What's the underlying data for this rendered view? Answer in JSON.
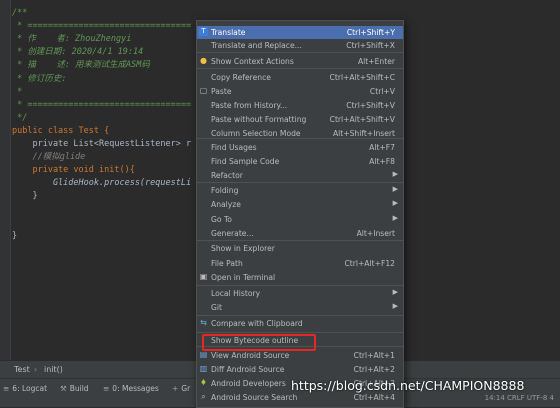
{
  "editor": {
    "lines": [
      {
        "cls": "c-doc",
        "text": "/**"
      },
      {
        "cls": "c-doc",
        "text": " * ================================"
      },
      {
        "cls": "c-doc",
        "text": " * 作    者: ZhouZhengyi"
      },
      {
        "cls": "c-doc",
        "text": " * 创建日期: 2020/4/1 19:14"
      },
      {
        "cls": "c-doc",
        "text": " * 描    述: 用来测试生成ASM码"
      },
      {
        "cls": "c-doc",
        "text": " * 修订历史:"
      },
      {
        "cls": "c-doc",
        "text": " * "
      },
      {
        "cls": "c-doc",
        "text": " * ================================"
      },
      {
        "cls": "c-doc",
        "text": " */"
      },
      {
        "cls": "c-kw",
        "text": "public class Test {"
      },
      {
        "cls": "code",
        "text": "    private List<RequestListener> r"
      },
      {
        "cls": "c-gray",
        "text": "    //模拟glide"
      },
      {
        "cls": "c-kw",
        "text": "    private void init(){"
      },
      {
        "cls": "c-italic",
        "text": "        GlideHook.process(requestLi"
      },
      {
        "cls": "code",
        "text": "    }"
      },
      {
        "cls": "code",
        "text": ""
      },
      {
        "cls": "code",
        "text": ""
      },
      {
        "cls": "code",
        "text": "}"
      }
    ]
  },
  "breadcrumb": {
    "class_name": "Test",
    "sep": "›",
    "method": "init()"
  },
  "toolbar": {
    "logcat": "6: Logcat",
    "build": "Build",
    "messages": "0: Messages",
    "gr": "Gr",
    "status": "14:14  CRLF  UTF-8  4"
  },
  "menu": {
    "items": [
      {
        "label": "Translate",
        "shortcut": "Ctrl+Shift+Y",
        "icon": "translate-icon",
        "glyph": "T"
      },
      {
        "label": "Translate and Replace...",
        "shortcut": "Ctrl+Shift+X"
      },
      {
        "label": "Show Context Actions",
        "shortcut": "Alt+Enter",
        "icon": "bulb-icon",
        "glyph": "●"
      },
      {
        "label": "Copy Reference",
        "shortcut": "Ctrl+Alt+Shift+C"
      },
      {
        "label": "Paste",
        "shortcut": "Ctrl+V",
        "icon": "paste-icon",
        "glyph": "▢"
      },
      {
        "label": "Paste from History...",
        "shortcut": "Ctrl+Shift+V"
      },
      {
        "label": "Paste without Formatting",
        "shortcut": "Ctrl+Alt+Shift+V"
      },
      {
        "label": "Column Selection Mode",
        "shortcut": "Alt+Shift+Insert"
      },
      {
        "label": "Find Usages",
        "shortcut": "Alt+F7"
      },
      {
        "label": "Find Sample Code",
        "shortcut": "Alt+F8"
      },
      {
        "label": "Refactor",
        "shortcut": "",
        "submenu": true
      },
      {
        "label": "Folding",
        "shortcut": "",
        "submenu": true
      },
      {
        "label": "Analyze",
        "shortcut": "",
        "submenu": true
      },
      {
        "label": "Go To",
        "shortcut": "",
        "submenu": true
      },
      {
        "label": "Generate...",
        "shortcut": "Alt+Insert"
      },
      {
        "label": "Show in Explorer",
        "shortcut": ""
      },
      {
        "label": "File Path",
        "shortcut": "Ctrl+Alt+F12"
      },
      {
        "label": "Open in Terminal",
        "shortcut": "",
        "icon": "terminal-icon",
        "glyph": "▣"
      },
      {
        "label": "Local History",
        "shortcut": "",
        "submenu": true
      },
      {
        "label": "Git",
        "shortcut": "",
        "submenu": true
      },
      {
        "label": "Compare with Clipboard",
        "shortcut": "",
        "icon": "compare-icon",
        "glyph": "⇆"
      },
      {
        "label": "Show Bytecode outline",
        "shortcut": ""
      },
      {
        "label": "View Android Source",
        "shortcut": "Ctrl+Alt+1",
        "icon": "android-source-icon",
        "glyph": "▤"
      },
      {
        "label": "Diff Android Source",
        "shortcut": "Ctrl+Alt+2",
        "icon": "diff-icon",
        "glyph": "▥"
      },
      {
        "label": "Android Developers",
        "shortcut": "Ctrl+Alt+3",
        "icon": "android-icon",
        "glyph": "♦"
      },
      {
        "label": "Android Source Search",
        "shortcut": "Ctrl+Alt+4",
        "icon": "search-icon",
        "glyph": "⌕"
      }
    ]
  },
  "colors": {
    "accent": "#4b6eaf",
    "highlight_border": "#e62727",
    "background": "#2b2b2b",
    "menu_bg": "#3c3f41"
  },
  "watermark": "https://blog.csdn.net/CHAMPION8888"
}
